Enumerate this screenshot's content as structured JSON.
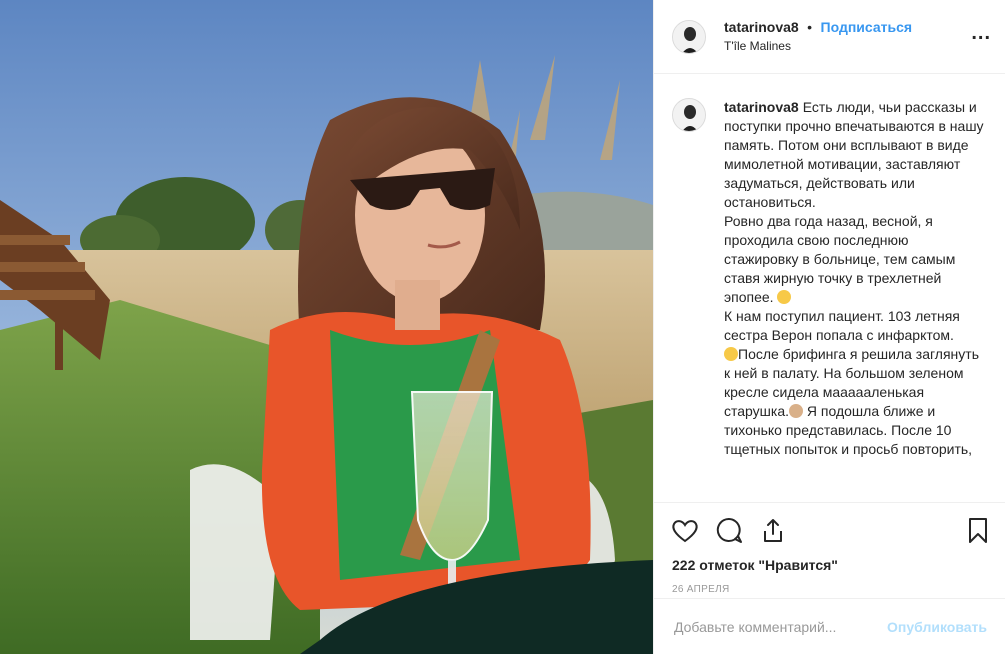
{
  "post": {
    "photo_alt": "",
    "header": {
      "username": "tatarinova8",
      "dot": "•",
      "follow_label": "Подписаться",
      "location": "T'île Malines",
      "more_label": "..."
    },
    "caption": {
      "username": "tatarinova8",
      "text": "Есть люди, чьи рассказы и поступки прочно впечатываются в нашу память. Потом они всплывают в виде мимолетной мотивации, заставляют задуматься, действовать или остановиться.\nРовно два года назад, весной, я проходила свою последнюю стажировку в больнице, тем самым ставя жирную точку в трехлетней эпопее.",
      "text2": "К нам поступил пациент. 103 летняя сестра Верон попала с инфарктом.",
      "text3": "После брифинга я решила заглянуть к ней в палату. На большом зеленом кресле сидела маааааленькая старушка.",
      "text4": "Я подошла ближе и тихонько представилась. После 10 тщетных попыток и просьб повторить,"
    },
    "actions": {
      "likes": "222 отметок \"Нравится\"",
      "date": "26 АПРЕЛЯ"
    },
    "comment_box": {
      "placeholder": "Добавьте комментарий...",
      "publish_label": "Опубликовать"
    },
    "icons": {
      "like": "heart-icon",
      "comment": "comment-bubble-icon",
      "share": "share-icon",
      "save": "bookmark-icon",
      "more": "more-dots-icon"
    },
    "colors": {
      "link_blue": "#3897f0",
      "publish_disabled": "#b2dffc",
      "muted": "#999999",
      "border": "#efefef"
    }
  }
}
